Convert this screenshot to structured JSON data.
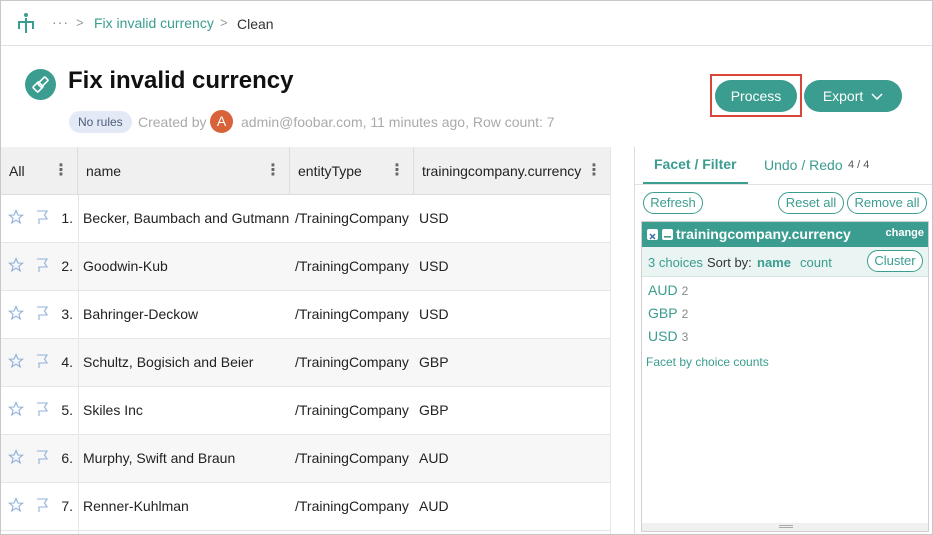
{
  "breadcrumb": {
    "ellipsis": "···",
    "parent": "Fix invalid currency",
    "current": "Clean"
  },
  "header": {
    "title": "Fix invalid currency",
    "rules_badge": "No rules",
    "created_by_label": "Created by",
    "avatar_initial": "A",
    "meta": "admin@foobar.com, 11 minutes ago, Row count: 7",
    "process_label": "Process",
    "export_label": "Export"
  },
  "table": {
    "columns": [
      "All",
      "name",
      "entityType",
      "trainingcompany.currency"
    ],
    "rows": [
      {
        "num": "1.",
        "name": "Becker, Baumbach and Gutmann",
        "entityType": "/TrainingCompany",
        "currency": "USD"
      },
      {
        "num": "2.",
        "name": "Goodwin-Kub",
        "entityType": "/TrainingCompany",
        "currency": "USD"
      },
      {
        "num": "3.",
        "name": "Bahringer-Deckow",
        "entityType": "/TrainingCompany",
        "currency": "USD"
      },
      {
        "num": "4.",
        "name": "Schultz, Bogisich and Beier",
        "entityType": "/TrainingCompany",
        "currency": "GBP"
      },
      {
        "num": "5.",
        "name": "Skiles Inc",
        "entityType": "/TrainingCompany",
        "currency": "GBP"
      },
      {
        "num": "6.",
        "name": "Murphy, Swift and Braun",
        "entityType": "/TrainingCompany",
        "currency": "AUD"
      },
      {
        "num": "7.",
        "name": "Renner-Kuhlman",
        "entityType": "/TrainingCompany",
        "currency": "AUD"
      }
    ]
  },
  "panel": {
    "tab_facet": "Facet / Filter",
    "tab_undo": "Undo / Redo",
    "undo_count": "4 / 4",
    "refresh_label": "Refresh",
    "reset_label": "Reset all",
    "remove_label": "Remove all",
    "facet": {
      "title": "trainingcompany.currency",
      "change_label": "change",
      "choices_count": "3 choices",
      "sort_by_label": "Sort by:",
      "sort_name": "name",
      "sort_count": "count",
      "cluster_label": "Cluster",
      "choices": [
        {
          "label": "AUD",
          "count": "2"
        },
        {
          "label": "GBP",
          "count": "2"
        },
        {
          "label": "USD",
          "count": "3"
        }
      ],
      "facet_by_counts": "Facet by choice counts"
    }
  },
  "colors": {
    "accent": "#3a9d8f",
    "highlight": "#d9453b",
    "avatar": "#d8633a"
  }
}
